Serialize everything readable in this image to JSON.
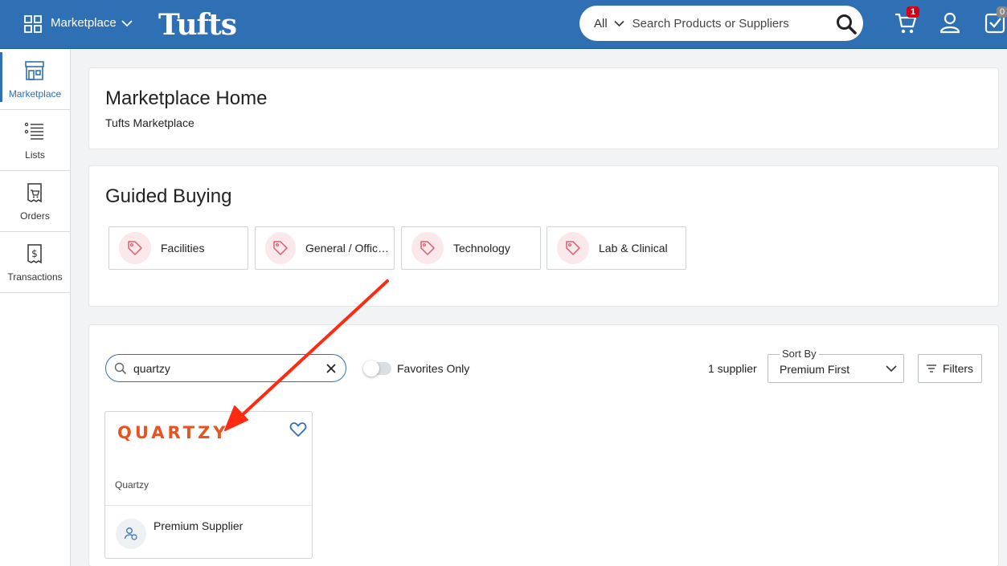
{
  "header": {
    "app_switcher": "Marketplace",
    "logo": "Tufts",
    "search_scope": "All",
    "search_placeholder": "Search Products or Suppliers",
    "cart_count": "1",
    "tasks_count": "0"
  },
  "sidebar": {
    "items": [
      {
        "label": "Marketplace",
        "icon": "storefront-icon"
      },
      {
        "label": "Lists",
        "icon": "list-icon"
      },
      {
        "label": "Orders",
        "icon": "orders-icon"
      },
      {
        "label": "Transactions",
        "icon": "transactions-icon"
      }
    ]
  },
  "home": {
    "title": "Marketplace Home",
    "subtitle": "Tufts Marketplace"
  },
  "guided_buying": {
    "title": "Guided Buying",
    "items": [
      {
        "label": "Facilities"
      },
      {
        "label": "General / Office Supplies"
      },
      {
        "label": "Technology"
      },
      {
        "label": "Lab & Clinical"
      }
    ]
  },
  "suppliers": {
    "search_value": "quartzy",
    "favorites_label": "Favorites Only",
    "count_label": "1 supplier",
    "sort_label": "Sort By",
    "sort_value": "Premium First",
    "filters_label": "Filters",
    "cards": [
      {
        "logo_text": "QUARTZY",
        "name": "Quartzy",
        "badge": "Premium Supplier"
      }
    ]
  },
  "colors": {
    "brand": "#2f6fb3",
    "annotation_arrow": "#ff2a12",
    "supplier_logo": "#e8531f"
  }
}
